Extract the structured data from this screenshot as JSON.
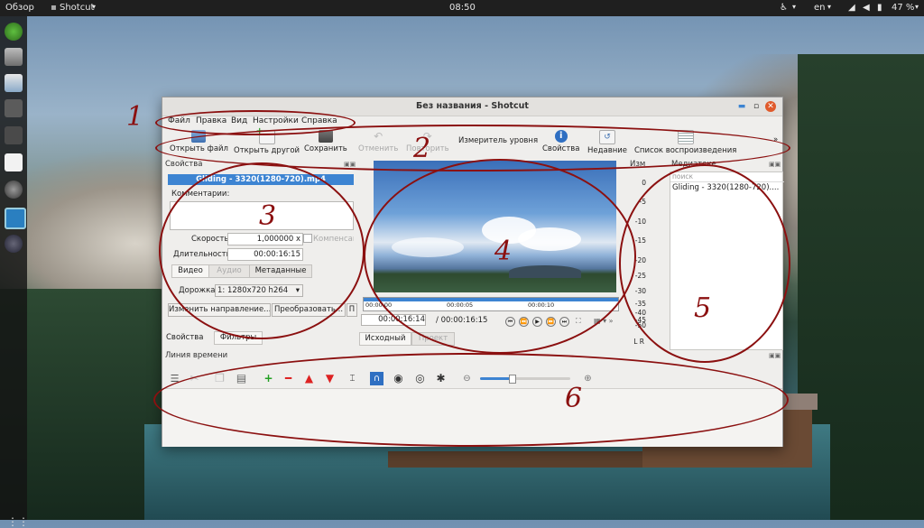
{
  "desktop": {
    "activities_label": "Обзор",
    "app_menu_label": "Shotcut",
    "clock": "08:50",
    "language": "en",
    "battery": "47 %"
  },
  "window": {
    "title": "Без названия - Shotcut"
  },
  "menu": [
    "Файл",
    "Правка",
    "Вид",
    "Настройки",
    "Справка"
  ],
  "toolbar": {
    "open_file": "Открыть файл",
    "open_other": "Открыть другой",
    "save": "Сохранить",
    "undo": "Отменить",
    "redo": "Повторить",
    "peak_meter": "Измеритель уровня",
    "properties": "Свойства",
    "recent": "Недавние",
    "playlist": "Список воспроизведения",
    "overflow": "»"
  },
  "properties_panel": {
    "header": "Свойства",
    "clip_title": "Gliding - 3320(1280-720).mp4",
    "comments_label": "Комментарии:",
    "speed_label": "Скорость",
    "speed_value": "1,000000 x",
    "compensate_label": "Компенсац",
    "duration_label": "Длительность",
    "duration_value": "00:00:16:15",
    "tabs": [
      "Видео",
      "Аудио",
      "Метаданные"
    ],
    "track_label": "Дорожка",
    "track_value": "1: 1280x720 h264",
    "btn_reverse": "Изменить направление...",
    "btn_convert": "Преобразовать...",
    "btn_more": "П",
    "bottom_tabs": [
      "Свойства",
      "Фильтры"
    ]
  },
  "player": {
    "ruler_ticks": [
      "00:00:00",
      "00:00:05",
      "00:00:10"
    ],
    "position": "00:00:16:14",
    "duration": "/ 00:00:16:15",
    "tabs": [
      "Исходный",
      "Проект"
    ]
  },
  "meter": {
    "header": "Изм",
    "scale": [
      "0",
      "-5",
      "-10",
      "-15",
      "-20",
      "-25",
      "-30",
      "-35",
      "-40",
      "-45",
      "-50"
    ],
    "channels": "L R"
  },
  "playlist_panel": {
    "header": "Медиатеке",
    "search_placeholder": "поиск",
    "items": [
      "Gliding - 3320(1280-720)...."
    ]
  },
  "timeline": {
    "header": "Линия времени",
    "zoom_level": 0.35
  },
  "annotations": [
    "1",
    "2",
    "3",
    "4",
    "5",
    "6"
  ]
}
